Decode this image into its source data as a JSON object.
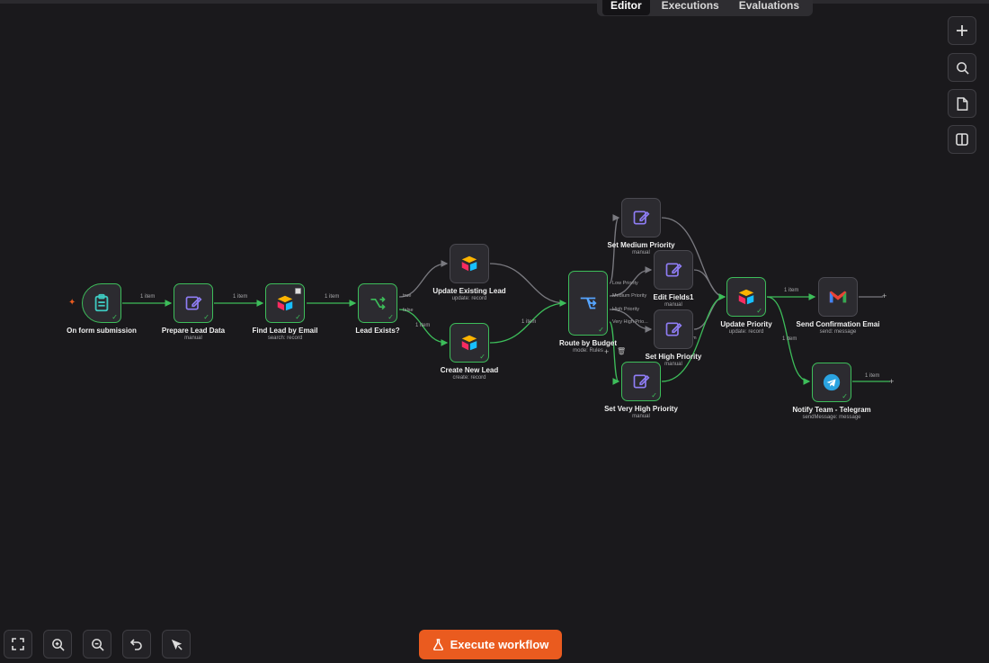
{
  "tabs": [
    "Editor",
    "Executions",
    "Evaluations"
  ],
  "execute_button": {
    "label": "Execute workflow"
  },
  "colors": {
    "accent": "#ea5b1f",
    "success": "#3dbd5a",
    "edge": "#3dbd5a",
    "edge_inactive": "#6f6f74"
  },
  "nodes": {
    "form": {
      "label": "On form submission",
      "sub": "",
      "icon": "clipboard-icon"
    },
    "prepare": {
      "label": "Prepare Lead Data",
      "sub": "manual",
      "icon": "edit-icon"
    },
    "find": {
      "label": "Find Lead by Email",
      "sub": "search: record",
      "icon": "airtable-icon"
    },
    "exists": {
      "label": "Lead Exists?",
      "sub": "",
      "icon": "if-icon"
    },
    "update_existing": {
      "label": "Update Existing Lead",
      "sub": "update: record",
      "icon": "airtable-icon"
    },
    "create_new": {
      "label": "Create New Lead",
      "sub": "create: record",
      "icon": "airtable-icon"
    },
    "route": {
      "label": "Route by Budget",
      "sub": "mode: Rules",
      "icon": "switch-icon"
    },
    "set_medium": {
      "label": "Set Medium Priority",
      "sub": "manual",
      "icon": "edit-icon"
    },
    "edit_fields": {
      "label": "Edit Fields1",
      "sub": "manual",
      "icon": "edit-icon"
    },
    "set_high": {
      "label": "Set High Priority",
      "sub": "manual",
      "icon": "edit-icon"
    },
    "set_very_high": {
      "label": "Set Very High Priority",
      "sub": "manual",
      "icon": "edit-icon"
    },
    "update_priority": {
      "label": "Update Priority",
      "sub": "update: record",
      "icon": "airtable-icon"
    },
    "send_email": {
      "label": "Send Confirmation Emai",
      "sub": "send: message",
      "icon": "gmail-icon"
    },
    "telegram": {
      "label": "Notify Team - Telegram",
      "sub": "sendMessage: message",
      "icon": "telegram-icon"
    }
  },
  "edge_labels": {
    "form_prepare": "1 item",
    "prepare_find": "1 item",
    "find_exists": "1 item",
    "exists_create": "1 item",
    "create_route": "1 item",
    "update_email": "1 item",
    "update_telegram": "1 item",
    "telegram_out": "1 item"
  },
  "if_outputs": {
    "true": "true",
    "false": "false"
  },
  "route_outputs": [
    "Low Priority",
    "Medium Priority",
    "High Priority",
    "Very High Prio..."
  ],
  "edit_fields_partial": "m"
}
